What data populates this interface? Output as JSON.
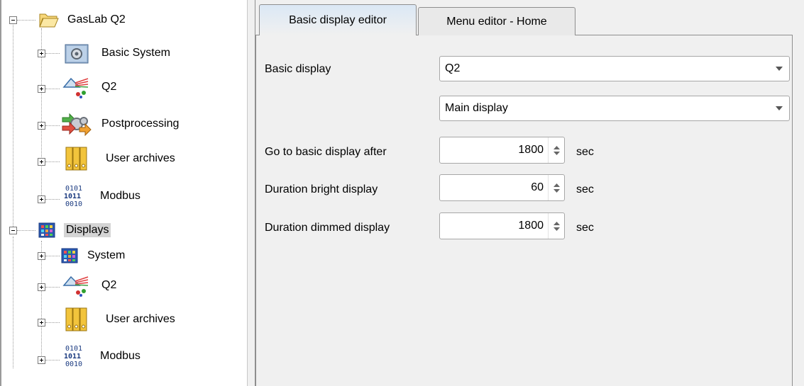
{
  "tree": {
    "root": {
      "label": "GasLab Q2",
      "icon": "folder-open-icon"
    },
    "root_children": [
      {
        "label": "Basic System",
        "icon": "gear-box-icon"
      },
      {
        "label": "Q2",
        "icon": "prism-icon"
      },
      {
        "label": "Postprocessing",
        "icon": "gears-arrows-icon"
      },
      {
        "label": "User archives",
        "icon": "archive-binders-icon"
      },
      {
        "label": "Modbus",
        "icon": "binary-icon"
      }
    ],
    "displays": {
      "label": "Displays",
      "icon": "display-grid-icon"
    },
    "displays_children": [
      {
        "label": "System",
        "icon": "display-grid-icon"
      },
      {
        "label": "Q2",
        "icon": "prism-icon"
      },
      {
        "label": "User archives",
        "icon": "archive-binders-icon"
      },
      {
        "label": "Modbus",
        "icon": "binary-icon"
      }
    ]
  },
  "tabs": [
    {
      "label": "Basic display editor",
      "active": true
    },
    {
      "label": "Menu editor - Home",
      "active": false
    }
  ],
  "form": {
    "basic_display_label": "Basic display",
    "basic_display_value": "Q2",
    "sub_display_value": "Main display",
    "goto_label": "Go to basic display after",
    "goto_value": "1800",
    "bright_label": "Duration bright display",
    "bright_value": "60",
    "dimmed_label": "Duration dimmed display",
    "dimmed_value": "1800",
    "unit": "sec"
  },
  "colors": {
    "selection": "#d4d4d4",
    "tab_active": "#dbe8f5",
    "panel": "#f0f0f0"
  }
}
